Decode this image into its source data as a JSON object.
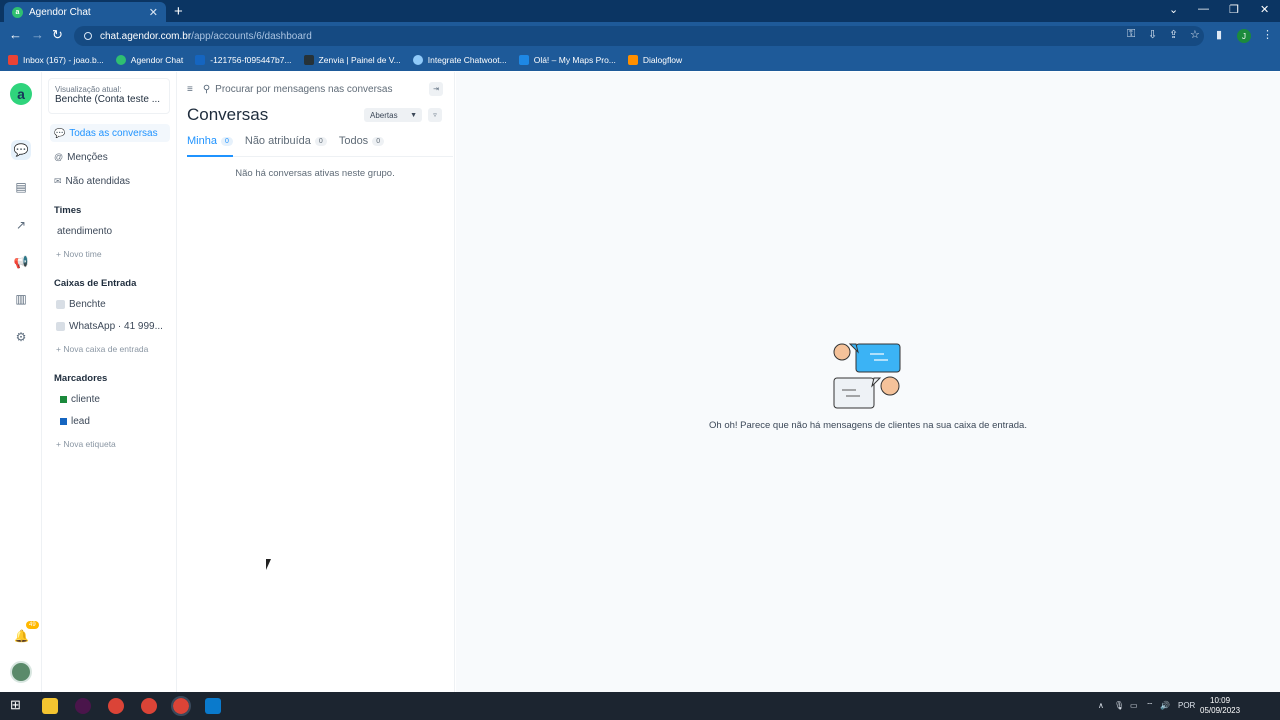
{
  "browser": {
    "tab_title": "Agendor Chat",
    "tab_close": "✕",
    "new_tab": "+",
    "url_domain": "chat.agendor.com.br",
    "url_path": "/app/accounts/6/dashboard",
    "profile_initial": "J",
    "bookmarks": [
      {
        "label": "Inbox (167) - joao.b...",
        "color": "#ea4335"
      },
      {
        "label": "Agendor Chat",
        "color": "#2fbf71"
      },
      {
        "label": "-121756-f095447b7...",
        "color": "#1565c0"
      },
      {
        "label": "Zenvia | Painel de V...",
        "color": "#263238"
      },
      {
        "label": "Integrate Chatwoot...",
        "color": "#90caf9"
      },
      {
        "label": "Olá! – My Maps Pro...",
        "color": "#1e88e5"
      },
      {
        "label": "Dialogflow",
        "color": "#ff8f00"
      }
    ]
  },
  "rail": {
    "logo_letter": "a",
    "notification_count": "49"
  },
  "sidebar": {
    "account_label": "Visualização atual:",
    "account_name": "Benchte (Conta teste ...",
    "nav": [
      {
        "label": "Todas as conversas",
        "icon": "💬"
      },
      {
        "label": "Menções",
        "icon": "@"
      },
      {
        "label": "Não atendidas",
        "icon": "✉"
      }
    ],
    "teams_title": "Times",
    "teams": [
      "atendimento"
    ],
    "new_team": "+ Novo time",
    "inboxes_title": "Caixas de Entrada",
    "inboxes": [
      "Benchte",
      "WhatsApp · 41 999..."
    ],
    "new_inbox": "+ Nova caixa de entrada",
    "labels_title": "Marcadores",
    "labels": [
      {
        "label": "cliente",
        "color": "#1b8a3c"
      },
      {
        "label": "lead",
        "color": "#1565c0"
      }
    ],
    "new_label": "+ Nova etiqueta"
  },
  "conversations": {
    "search_placeholder": "Procurar por mensagens nas conversas",
    "title": "Conversas",
    "status_filter": "Abertas",
    "tabs": [
      {
        "label": "Minha",
        "count": "0"
      },
      {
        "label": "Não atribuída",
        "count": "0"
      },
      {
        "label": "Todos",
        "count": "0"
      }
    ],
    "empty_message": "Não há conversas ativas neste grupo."
  },
  "main": {
    "empty_message": "Oh oh! Parece que não há mensagens de clientes na sua caixa de entrada."
  },
  "taskbar": {
    "language": "POR",
    "time": "10:09",
    "date": "05/09/2023"
  }
}
